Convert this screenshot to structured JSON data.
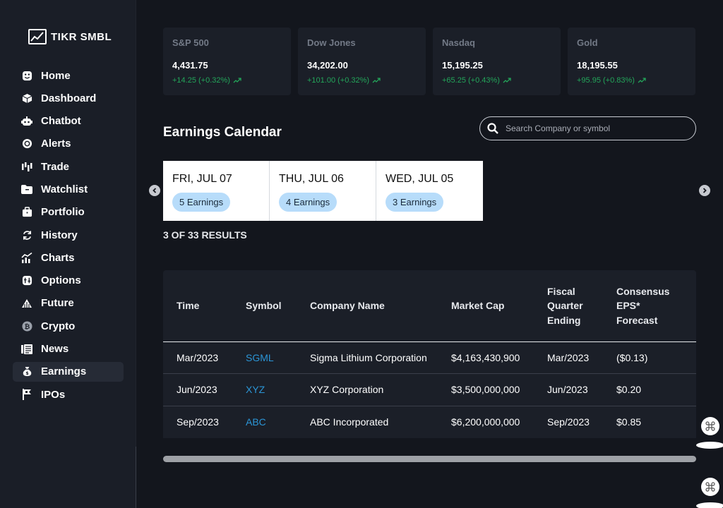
{
  "brand": {
    "name": "TIKR SMBL"
  },
  "sidebar": {
    "items": [
      {
        "label": "Home",
        "icon": "smiley-icon"
      },
      {
        "label": "Dashboard",
        "icon": "cube-icon"
      },
      {
        "label": "Chatbot",
        "icon": "robot-icon"
      },
      {
        "label": "Alerts",
        "icon": "alert-icon"
      },
      {
        "label": "Trade",
        "icon": "candlestick-icon"
      },
      {
        "label": "Watchlist",
        "icon": "folder-icon"
      },
      {
        "label": "Portfolio",
        "icon": "briefcase-icon"
      },
      {
        "label": "History",
        "icon": "history-icon"
      },
      {
        "label": "Charts",
        "icon": "chart-icon"
      },
      {
        "label": "Options",
        "icon": "options-icon"
      },
      {
        "label": "Future",
        "icon": "future-icon"
      },
      {
        "label": "Crypto",
        "icon": "bitcoin-icon"
      },
      {
        "label": "News",
        "icon": "news-icon"
      },
      {
        "label": "Earnings",
        "icon": "money-bag-icon",
        "active": true
      },
      {
        "label": "IPOs",
        "icon": "flag-icon"
      }
    ]
  },
  "tickers": [
    {
      "name": "S&P 500",
      "value": "4,431.75",
      "change": "+14.25 (+0.32%)"
    },
    {
      "name": "Dow Jones",
      "value": "34,202.00",
      "change": "+101.00 (+0.32%)"
    },
    {
      "name": "Nasdaq",
      "value": "15,195.25",
      "change": "+65.25 (+0.43%)"
    },
    {
      "name": "Gold",
      "value": "18,195.55",
      "change": "+95.95 (+0.83%)"
    }
  ],
  "colors": {
    "positive": "#23a55a",
    "accent": "#2b95d6",
    "badge": "#b7dcfa"
  },
  "earnings": {
    "title": "Earnings Calendar",
    "search_placeholder": "Search Company or symbol",
    "dates": [
      {
        "date": "FRI, JUL 07",
        "badge": "5 Earnings"
      },
      {
        "date": "THU, JUL 06",
        "badge": "4 Earnings"
      },
      {
        "date": "WED, JUL 05",
        "badge": "3 Earnings"
      }
    ],
    "results": "3 OF 33 RESULTS"
  },
  "table": {
    "headers": [
      "Time",
      "Symbol",
      "Company Name",
      "Market Cap",
      "Fiscal Quarter Ending",
      "Consensus EPS* Forecast"
    ],
    "rows": [
      [
        "Mar/2023",
        "SGML",
        "Sigma Lithium Corporation",
        "$4,163,430,900",
        "Mar/2023",
        "($0.13)"
      ],
      [
        "Jun/2023",
        "XYZ",
        "XYZ Corporation",
        "$3,500,000,000",
        "Jun/2023",
        "$0.20"
      ],
      [
        "Sep/2023",
        "ABC",
        "ABC Incorporated",
        "$6,200,000,000",
        "Sep/2023",
        "$0.85"
      ]
    ]
  }
}
